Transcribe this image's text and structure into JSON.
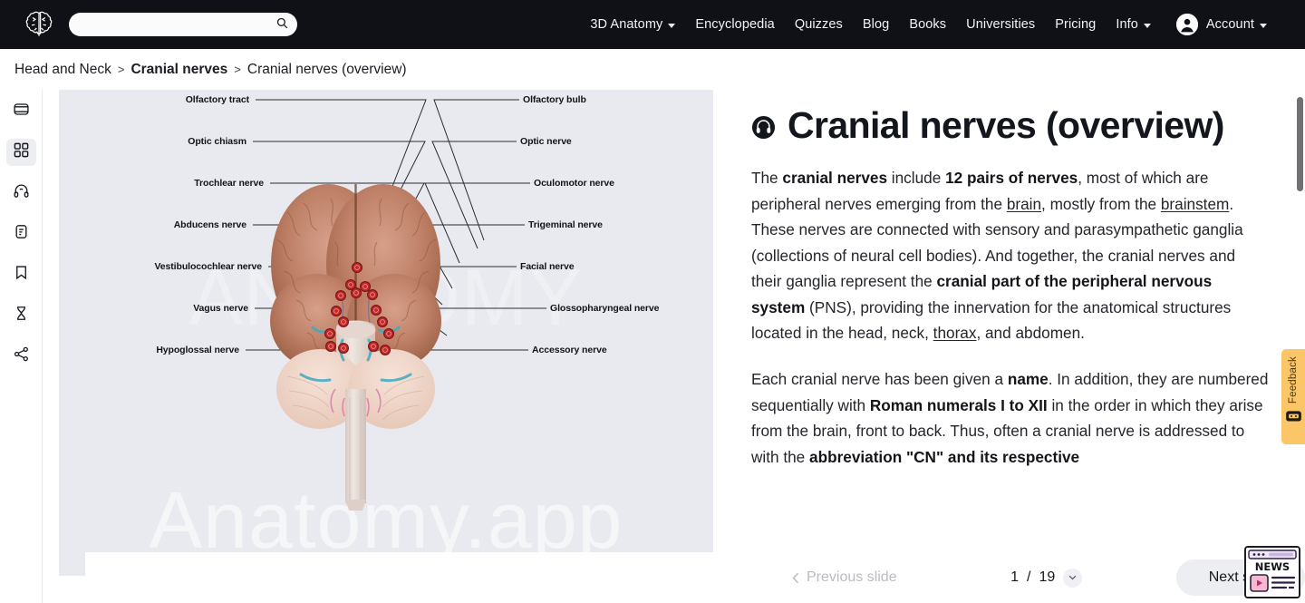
{
  "header": {
    "logo_name": "brain-logo",
    "search": {
      "value": "",
      "placeholder": ""
    },
    "nav": [
      {
        "label": "3D Anatomy",
        "has_caret": true
      },
      {
        "label": "Encyclopedia",
        "has_caret": false
      },
      {
        "label": "Quizzes",
        "has_caret": false
      },
      {
        "label": "Blog",
        "has_caret": false
      },
      {
        "label": "Books",
        "has_caret": false
      },
      {
        "label": "Universities",
        "has_caret": false
      },
      {
        "label": "Pricing",
        "has_caret": false
      },
      {
        "label": "Info",
        "has_caret": true
      }
    ],
    "account_label": "Account"
  },
  "breadcrumb": {
    "item1": "Head and Neck",
    "sep1": ">",
    "item2": "Cranial nerves",
    "sep2": ">",
    "item3": "Cranial nerves (overview)"
  },
  "rail": [
    {
      "icon": "slideshow-icon",
      "active": false
    },
    {
      "icon": "grid-icon",
      "active": true
    },
    {
      "icon": "headphones-icon",
      "active": false
    },
    {
      "icon": "clipboard-icon",
      "active": false
    },
    {
      "icon": "bookmark-icon",
      "active": false
    },
    {
      "icon": "hourglass-icon",
      "active": false
    },
    {
      "icon": "share-icon",
      "active": false
    }
  ],
  "illustration": {
    "watermark_top": "ANATOMY",
    "watermark_bottom": "Anatomy.app",
    "labels_left": [
      "Olfactory tract",
      "Optic chiasm",
      "Trochlear nerve",
      "Abducens nerve",
      "Vestibulocochlear nerve",
      "Vagus nerve",
      "Hypoglossal nerve"
    ],
    "labels_right": [
      "Olfactory bulb",
      "Optic nerve",
      "Oculomotor nerve",
      "Trigeminal nerve",
      "Facial nerve",
      "Glossopharyngeal nerve",
      "Accessory nerve"
    ]
  },
  "article": {
    "title_icon": "headphones-audio-icon",
    "title": "Cranial nerves (overview)",
    "paragraphs": [
      {
        "runs": [
          {
            "t": "The ",
            "s": "n"
          },
          {
            "t": "cranial nerves",
            "s": "b"
          },
          {
            "t": " include ",
            "s": "n"
          },
          {
            "t": "12 pairs of nerves",
            "s": "b"
          },
          {
            "t": ", most of which are peripheral nerves emerging from the ",
            "s": "n"
          },
          {
            "t": "brain",
            "s": "u"
          },
          {
            "t": ", mostly from the ",
            "s": "n"
          },
          {
            "t": "brainstem",
            "s": "u"
          },
          {
            "t": ". These nerves are connected with sensory and parasympathetic ganglia (collections of neural cell bodies). And together, the cranial nerves and their ganglia represent the ",
            "s": "n"
          },
          {
            "t": "cranial part of the peripheral nervous system",
            "s": "b"
          },
          {
            "t": " (PNS), providing the innervation for the anatomical structures located in the head, neck, ",
            "s": "n"
          },
          {
            "t": "thorax",
            "s": "u"
          },
          {
            "t": ", and abdomen.",
            "s": "n"
          }
        ]
      },
      {
        "runs": [
          {
            "t": "Each cranial nerve has been given a ",
            "s": "n"
          },
          {
            "t": "name",
            "s": "b"
          },
          {
            "t": ". In addition, they are numbered sequentially with ",
            "s": "n"
          },
          {
            "t": "Roman numerals I to XII",
            "s": "b"
          },
          {
            "t": " in the order in which they arise from the brain, front to back. Thus, often a cranial nerve is addressed to with the ",
            "s": "n"
          },
          {
            "t": "abbreviation \"CN\" and its respective",
            "s": "b"
          }
        ]
      }
    ]
  },
  "feedback": {
    "label": "Feedback",
    "color": "#fbc667"
  },
  "slidebar": {
    "prev_label": "Previous slide",
    "counter_current": "1",
    "counter_sep": "/",
    "counter_total": "19",
    "next_label": "Next slide"
  },
  "news_widget": {
    "label": "NEWS"
  },
  "colors": {
    "header_bg": "#0f1117",
    "illustration_bg": "#e9eaef",
    "accent_button": "#eceef2",
    "feedback": "#fbc667",
    "marker": "#c22a2a"
  }
}
